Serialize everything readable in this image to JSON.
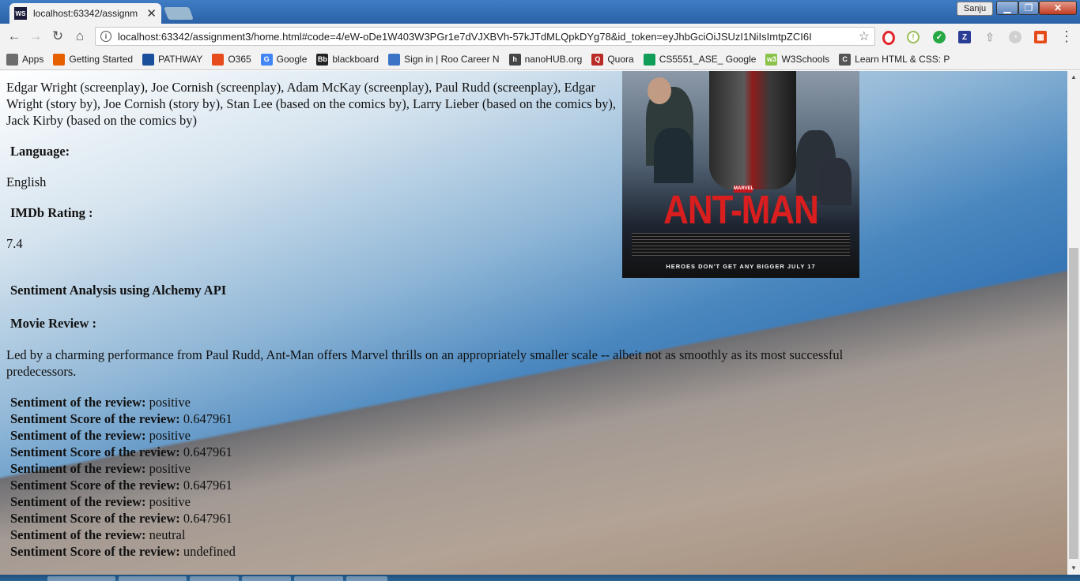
{
  "browser": {
    "tab_title": "localhost:63342/assignm",
    "tab_favicon": "WS",
    "url": "localhost:63342/assignment3/home.html#code=4/eW-oDe1W403W3PGr1e7dVJXBVh-57kJTdMLQpkDYg78&id_token=eyJhbGciOiJSUzI1NiIsImtpZCI6I",
    "user_name": "Sanju",
    "icons": [
      "back-arrow-icon",
      "forward-arrow-icon",
      "reload-icon",
      "home-icon",
      "info-icon",
      "star-icon",
      "menu-icon"
    ]
  },
  "bookmarks": [
    {
      "label": "Apps",
      "icon_text": "",
      "color": "#6d6d6d"
    },
    {
      "label": "Getting Started",
      "icon_text": "",
      "color": "#e66000"
    },
    {
      "label": "PATHWAY",
      "icon_text": "",
      "color": "#1a4f9c"
    },
    {
      "label": "O365",
      "icon_text": "",
      "color": "#e74c1c"
    },
    {
      "label": "Google",
      "icon_text": "G",
      "color": "#4285f4"
    },
    {
      "label": "blackboard",
      "icon_text": "Bb",
      "color": "#222222"
    },
    {
      "label": "Sign in | Roo Career N",
      "icon_text": "",
      "color": "#3b73c7"
    },
    {
      "label": "nanoHUB.org",
      "icon_text": "h",
      "color": "#444444"
    },
    {
      "label": "Quora",
      "icon_text": "Q",
      "color": "#b92b27"
    },
    {
      "label": "CS5551_ASE_ Google",
      "icon_text": "",
      "color": "#0f9d58"
    },
    {
      "label": "W3Schools",
      "icon_text": "w3",
      "color": "#8bc34a"
    },
    {
      "label": "Learn HTML & CSS: P",
      "icon_text": "C",
      "color": "#555555"
    }
  ],
  "movie": {
    "writers": "Edgar Wright (screenplay), Joe Cornish (screenplay), Adam McKay (screenplay), Paul Rudd (screenplay), Edgar Wright (story by), Joe Cornish (story by), Stan Lee (based on the comics by), Larry Lieber (based on the comics by), Jack Kirby (based on the comics by)",
    "language_label": "Language:",
    "language_value": "English",
    "rating_label": "IMDb Rating :",
    "rating_value": "7.4",
    "sentiment_title": "Sentiment Analysis using Alchemy API",
    "review_label": "Movie Review :",
    "review_text": "Led by a charming performance from Paul Rudd, Ant-Man offers Marvel thrills on an appropriately smaller scale -- albeit not as smoothly as its most successful predecessors."
  },
  "poster": {
    "title": "ANT-MAN",
    "brand": "MARVEL",
    "tagline": "HEROES DON'T GET ANY BIGGER JULY 17"
  },
  "sentiments": [
    {
      "label": "Sentiment of the review:",
      "value": "positive"
    },
    {
      "label": "Sentiment Score of the review:",
      "value": "0.647961"
    },
    {
      "label": "Sentiment of the review:",
      "value": "positive"
    },
    {
      "label": "Sentiment Score of the review:",
      "value": "0.647961"
    },
    {
      "label": "Sentiment of the review:",
      "value": "positive"
    },
    {
      "label": "Sentiment Score of the review:",
      "value": "0.647961"
    },
    {
      "label": "Sentiment of the review:",
      "value": "positive"
    },
    {
      "label": "Sentiment Score of the review:",
      "value": "0.647961"
    },
    {
      "label": "Sentiment of the review:",
      "value": "neutral"
    },
    {
      "label": "Sentiment Score of the review:",
      "value": "undefined"
    }
  ]
}
